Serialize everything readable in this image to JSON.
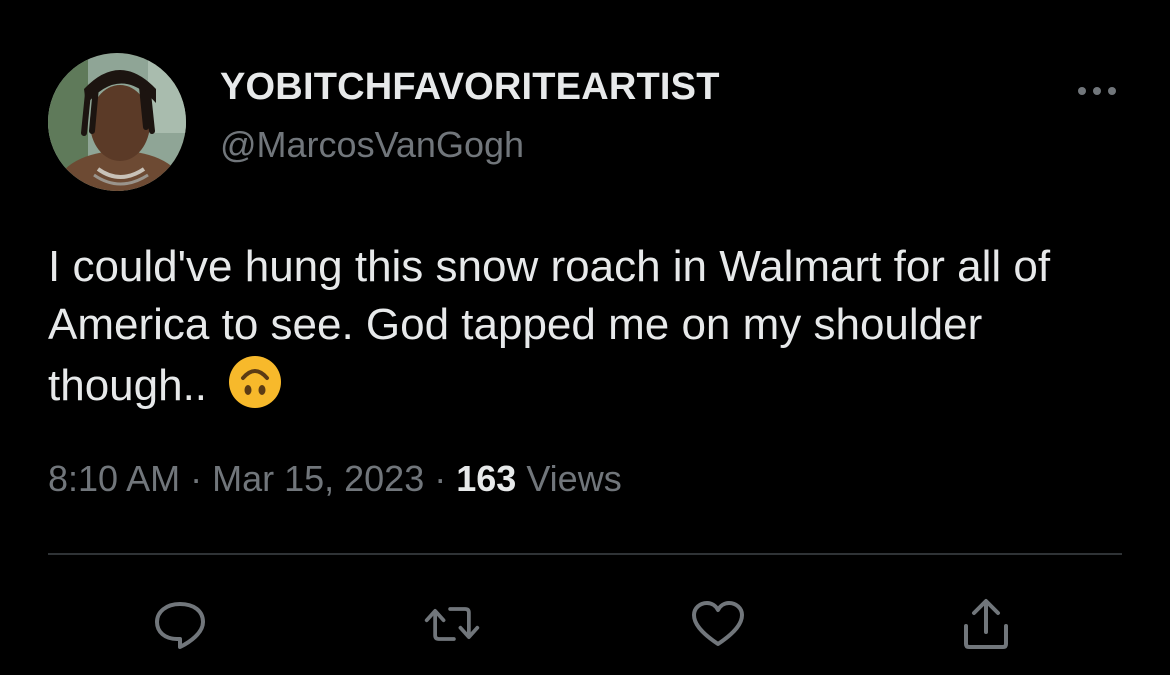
{
  "author": {
    "display_name": "YOBITCHFAVORITEARTIST",
    "handle": "@MarcosVanGogh",
    "avatar_icon": "profile-photo"
  },
  "more_icon": "more-horizontal-icon",
  "tweet": {
    "text": "I could've hung this snow roach in Walmart for all of America to see. God tapped me on my shoulder though.. ",
    "emoji": "upside-down-face-emoji"
  },
  "meta": {
    "time": "8:10 AM",
    "separator_1": " · ",
    "date": "Mar 15, 2023",
    "separator_2": " · ",
    "views_count": "163",
    "views_label": " Views"
  },
  "actions": [
    {
      "name": "reply",
      "icon": "reply-icon"
    },
    {
      "name": "retweet",
      "icon": "retweet-icon"
    },
    {
      "name": "like",
      "icon": "heart-icon"
    },
    {
      "name": "share",
      "icon": "share-icon"
    }
  ],
  "colors": {
    "background": "#000000",
    "primary_text": "#e7e9ea",
    "secondary_text": "#71767b",
    "divider": "#2f3336",
    "emoji_yellow": "#f7b92b"
  }
}
